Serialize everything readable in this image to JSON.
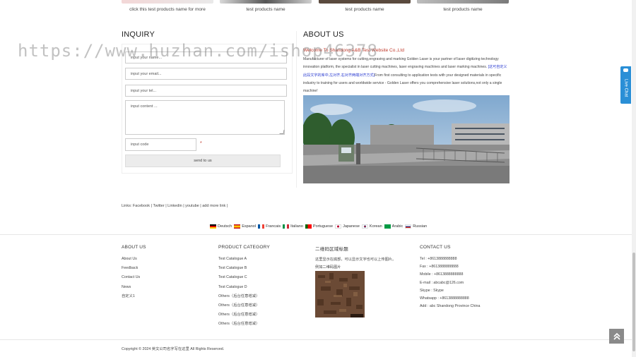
{
  "products": {
    "labels": [
      "click this test products name for more",
      "test products name",
      "test products name",
      "test products name"
    ]
  },
  "inquiry": {
    "title": "INQUIRY",
    "name_placeholder": "input your name...",
    "email_placeholder": "input your email...",
    "tel_placeholder": "input your tel...",
    "content_placeholder": "input content ...",
    "code_placeholder": "input code",
    "required_mark": "*",
    "send_label": "send to us"
  },
  "about": {
    "title": "ABOUT US",
    "welcome": "Welcome To Shandong A&B Test Website Co.,Ltd",
    "text_a": "Manufacturer of laser systems for cutting,engraving and marking Golden Laser is your partner of laser digitizing technology innovation platform, the specialist in laser cutting machines, laser engraving machines and laser marking machines.",
    "text_highlight": "[这可自定义此段文字的库中,左对齐,右对齐两端对齐方式]",
    "text_b": "From first consulting to application tests with your designed materials in specific industry to training for users and worldwide service - Golden Laser offers you comprehensive laser solutions,not only a single machine!"
  },
  "links": {
    "prefix": "Links:",
    "items": [
      "Facebook",
      "Twitter",
      "Linkedin",
      "youtube",
      "add more link"
    ],
    "separator": "|"
  },
  "languages": [
    {
      "name": "Deutsch",
      "color": "#000000"
    },
    {
      "name": "Espanol",
      "color": "#c60b1e"
    },
    {
      "name": "Francais",
      "color": "#0055a4"
    },
    {
      "name": "Italiano",
      "color": "#009246"
    },
    {
      "name": "Portuguese",
      "color": "#006600"
    },
    {
      "name": "Japanese",
      "color": "#bc002d"
    },
    {
      "name": "Korean",
      "color": "#cd2e3a"
    },
    {
      "name": "Arabic",
      "color": "#009a44"
    },
    {
      "name": "Russian",
      "color": "#0039a6"
    }
  ],
  "footer": {
    "about_title": "ABOUT US",
    "about_items": [
      "About Us",
      "Feedback",
      "Contact Us",
      "News",
      "自定义1"
    ],
    "category_title": "PRODUCT CATEGORY",
    "category_items": [
      "Test Catalogue A",
      "Test Catalogue B",
      "Test Catalogue C",
      "Test Catalogue D",
      "Others（后台任意增减）",
      "Others（后台任意增减）",
      "Others（后台任意增减）",
      "Others（后台任意增减）"
    ],
    "qr_title": "二维码区域标题",
    "qr_text_1": "这里显示在底部，可以显示文字也可以上传图片。",
    "qr_text_2": "例如二维码图片",
    "contact_title": "CONTACT US",
    "contact_items": [
      "Tel : +8613888888888",
      "Fax : +8613888888888",
      "Mobile : +8613888888888",
      "E-mail : abcabc@126.com",
      "Skype : Skype",
      "Whatsapp : +8613888888888",
      "Add : abc Shandong Province China"
    ],
    "copyright": "Copyright © 2024 英文公司名字写在这里 All Rights Reserved."
  },
  "live_chat": "Live Chat",
  "watermark": "https://www.huzhan.com/ishop46378",
  "colors": {
    "accent_red": "#c0392b",
    "link_blue": "#2a3bd1",
    "live_chat_blue": "#2a8fd6",
    "back_top_gray": "#8a8a8a"
  }
}
